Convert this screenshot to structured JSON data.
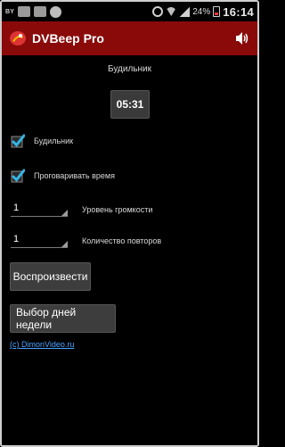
{
  "status_bar": {
    "tag_left": "BY",
    "battery_percent": "24%",
    "time": "16:14"
  },
  "action_bar": {
    "title": "DVBeep Pro"
  },
  "alarm": {
    "title": "Будильник",
    "time": "05:31"
  },
  "checks": {
    "alarm_label": "Будильник",
    "speak_time_label": "Проговаривать время"
  },
  "spinners": {
    "volume_value": "1",
    "volume_label": "Уровень громкости",
    "repeats_value": "1",
    "repeats_label": "Количество повторов"
  },
  "buttons": {
    "play_label": "Воспроизвести",
    "weekdays_label": "Выбор дней недели"
  },
  "footer": {
    "copyright": "(c) DimonVideo.ru"
  },
  "colors": {
    "action_bar": "#8a0a0a",
    "check_accent": "#33b5e5",
    "link": "#4aa3ff"
  }
}
